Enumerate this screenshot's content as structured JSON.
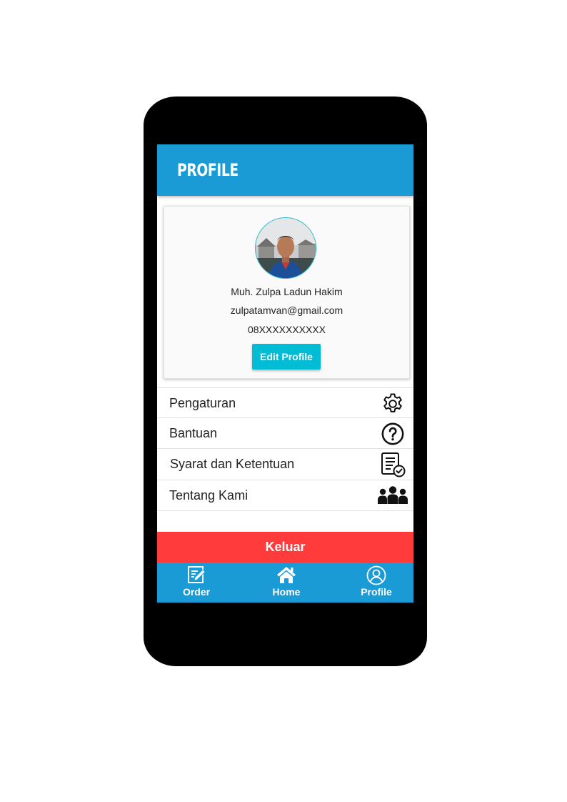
{
  "header": {
    "title": "PROFILE",
    "color": "#1a9bd6"
  },
  "profile": {
    "avatar_icon": "user-photo",
    "name": "Muh. Zulpa Ladun Hakim",
    "email": "zulpatamvan@gmail.com",
    "phone": "08XXXXXXXXXX",
    "edit_label": "Edit Profile",
    "edit_color": "#00bcd4"
  },
  "menu": {
    "items": [
      {
        "label": "Pengaturan",
        "icon": "gear-icon"
      },
      {
        "label": "Bantuan",
        "icon": "help-circle-icon"
      },
      {
        "label": "Syarat dan Ketentuan",
        "icon": "document-check-icon"
      },
      {
        "label": "Tentang Kami",
        "icon": "team-icon"
      }
    ]
  },
  "logout": {
    "label": "Keluar",
    "color": "#ff3b3b"
  },
  "bottom_nav": {
    "items": [
      {
        "label": "Order",
        "icon": "edit-note-icon"
      },
      {
        "label": "Home",
        "icon": "home-icon"
      },
      {
        "label": "Profile",
        "icon": "user-circle-icon"
      }
    ]
  }
}
